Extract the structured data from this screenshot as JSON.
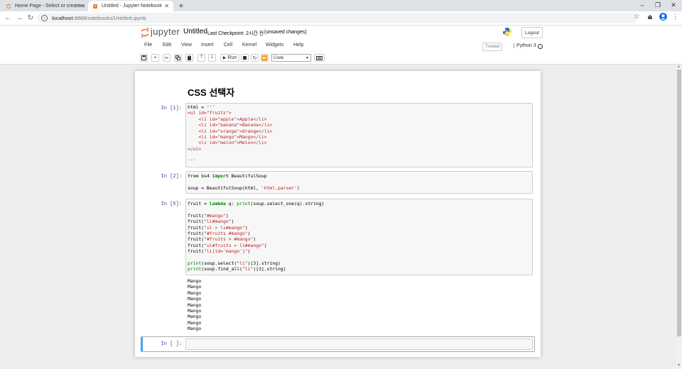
{
  "browser": {
    "tabs": [
      {
        "title": "Home Page - Select or create a",
        "active": false
      },
      {
        "title": "Untitled - Jupyter Notebook",
        "active": true
      }
    ],
    "url_host": "localhost",
    "url_rest": ":8888/notebooks/Untitled.ipynb",
    "window_controls": [
      "–",
      "❐",
      "✕"
    ]
  },
  "header": {
    "logo_text": "jupyter",
    "notebook_title": "Untitled",
    "checkpoint": "Last Checkpoint: 2시간 전",
    "unsaved": "(unsaved changes)",
    "logout_label": "Logout"
  },
  "menu": {
    "items": [
      "File",
      "Edit",
      "View",
      "Insert",
      "Cell",
      "Kernel",
      "Widgets",
      "Help"
    ],
    "trusted": "Trusted",
    "kernel": "Python 3"
  },
  "toolbar": {
    "run_label": "Run",
    "cell_type": "Code"
  },
  "notebook": {
    "heading": "CSS 선택자",
    "cells": [
      {
        "prompt": "In [1]:"
      },
      {
        "prompt": "In [2]:"
      },
      {
        "prompt": "In [5]:",
        "output": [
          "Mango",
          "Mango",
          "Mango",
          "Mango",
          "Mango",
          "Mango",
          "Mango",
          "Mango",
          "Mango"
        ]
      },
      {
        "prompt": "In [ ]:"
      }
    ]
  },
  "colors": {
    "prompt": "#303f9f",
    "keyword": "#008000",
    "string": "#ba2121",
    "selected_cell": "#42a5f5"
  }
}
